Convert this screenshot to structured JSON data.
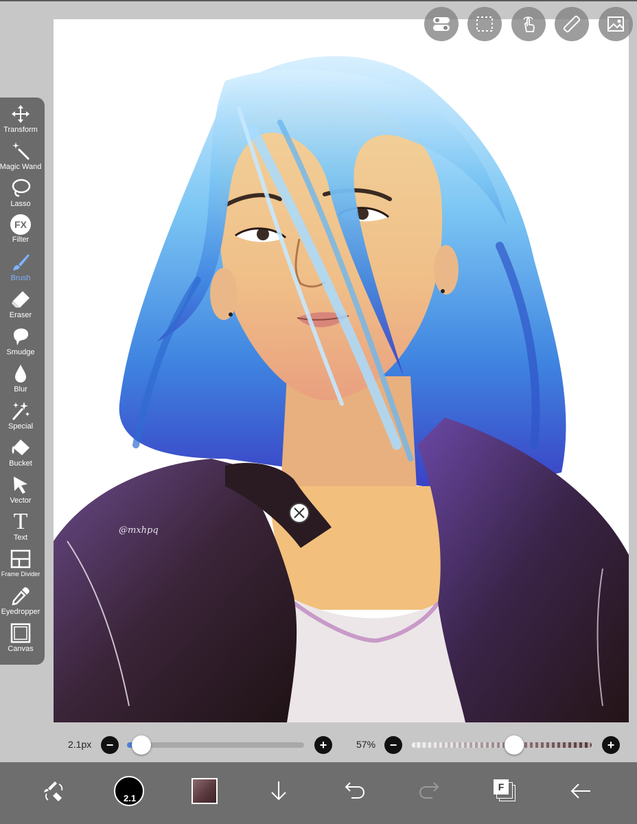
{
  "tools": [
    {
      "label": "Transform",
      "icon": "move-arrows-icon"
    },
    {
      "label": "Magic Wand",
      "icon": "magic-wand-icon"
    },
    {
      "label": "Lasso",
      "icon": "lasso-icon"
    },
    {
      "label": "Filter",
      "icon": "fx-icon",
      "glyph": "FX"
    },
    {
      "label": "Brush",
      "icon": "brush-icon",
      "active": true
    },
    {
      "label": "Eraser",
      "icon": "eraser-icon"
    },
    {
      "label": "Smudge",
      "icon": "smudge-icon"
    },
    {
      "label": "Blur",
      "icon": "droplet-icon"
    },
    {
      "label": "Special",
      "icon": "sparkles-icon"
    },
    {
      "label": "Bucket",
      "icon": "bucket-icon"
    },
    {
      "label": "Vector",
      "icon": "cursor-arrow-icon"
    },
    {
      "label": "Text",
      "icon": "text-icon",
      "glyph": "T"
    },
    {
      "label": "Frame Divider",
      "icon": "frame-divider-icon"
    },
    {
      "label": "Eyedropper",
      "icon": "eyedropper-icon"
    },
    {
      "label": "Canvas",
      "icon": "canvas-icon"
    }
  ],
  "top_buttons": [
    "toggle-icon",
    "selection-icon",
    "touch-icon",
    "ruler-icon",
    "image-icon"
  ],
  "sliders": {
    "size": {
      "label": "2.1px",
      "value_fraction": 0.08
    },
    "opacity": {
      "label": "57%",
      "value_fraction": 0.57
    },
    "minus_glyph": "−",
    "plus_glyph": "+"
  },
  "bottom_bar": {
    "brush_size_label": "2.1",
    "layers_glyph": "F",
    "primary_color": "#000000",
    "secondary_color": "#5a3a3e"
  },
  "artwork": {
    "signature": "@mxhpq"
  },
  "colors": {
    "active_tool": "#7fb2ff",
    "toolbar_bg": "#6b6b6b",
    "bottombar_bg": "#6e6e6e"
  }
}
